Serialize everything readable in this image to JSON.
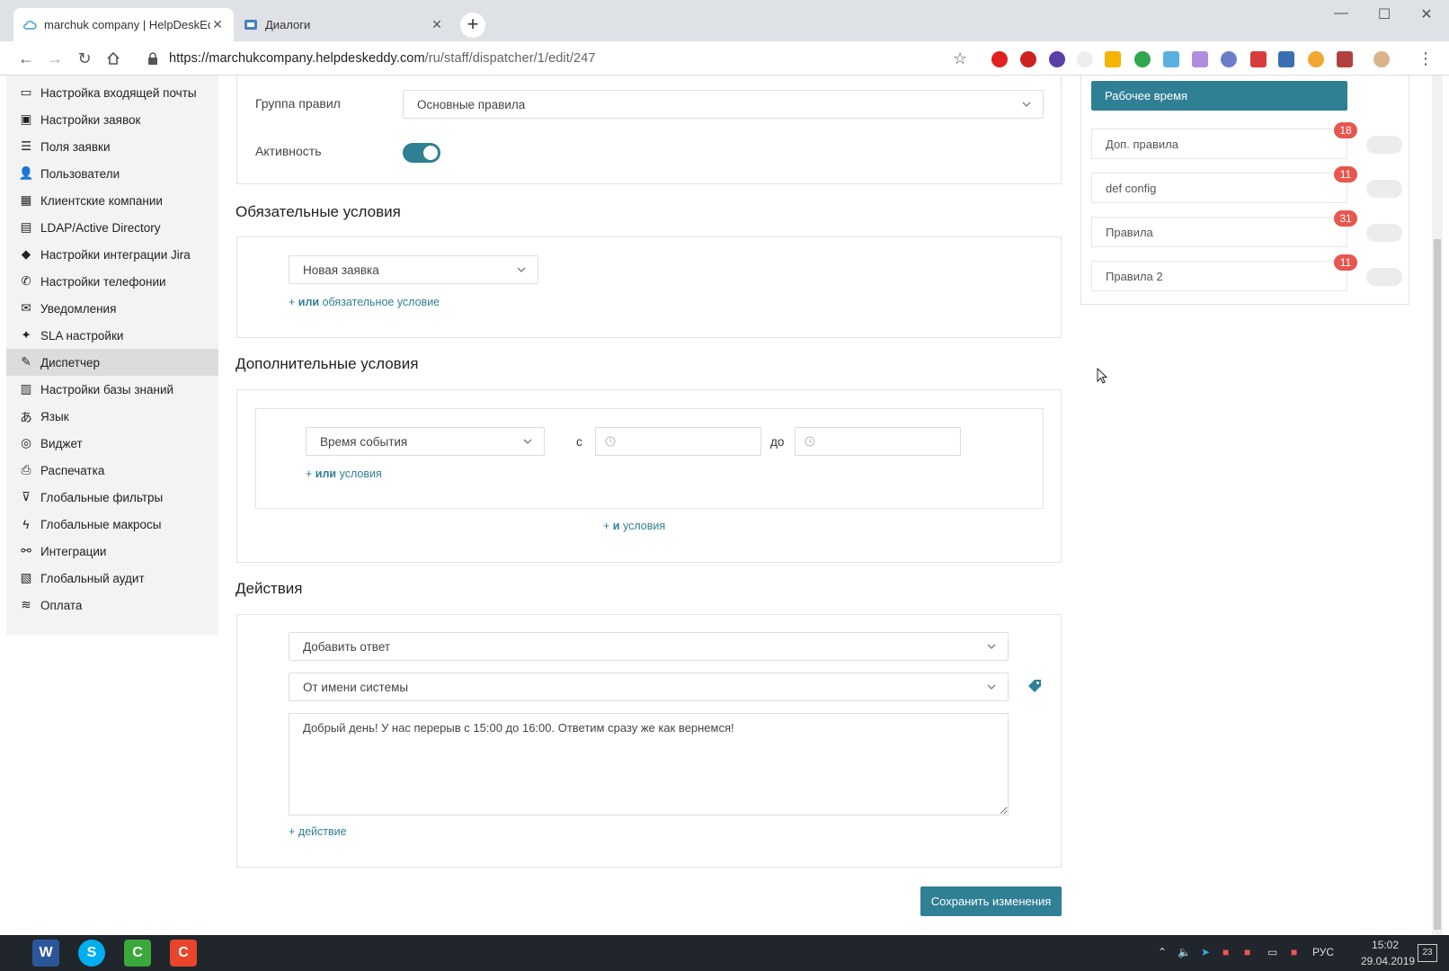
{
  "browser": {
    "tabs": [
      {
        "title": "marchuk company | HelpDeskEddy",
        "active": true
      },
      {
        "title": "Диалоги",
        "active": false
      }
    ],
    "url_main": "https://marchukcompany.helpdeskeddy.com",
    "url_path": "/ru/staff/dispatcher/1/edit/247"
  },
  "sidebar": {
    "items": [
      {
        "label": "Настройка входящей почты",
        "icon": "inbox-icon"
      },
      {
        "label": "Настройки заявок",
        "icon": "ticket-settings-icon"
      },
      {
        "label": "Поля заявки",
        "icon": "fields-icon"
      },
      {
        "label": "Пользователи",
        "icon": "users-icon"
      },
      {
        "label": "Клиентские компании",
        "icon": "company-icon"
      },
      {
        "label": "LDAP/Active Directory",
        "icon": "ldap-icon"
      },
      {
        "label": "Настройки интеграции Jira",
        "icon": "jira-icon"
      },
      {
        "label": "Настройки телефонии",
        "icon": "phone-icon"
      },
      {
        "label": "Уведомления",
        "icon": "envelope-icon"
      },
      {
        "label": "SLA настройки",
        "icon": "handshake-icon"
      },
      {
        "label": "Диспетчер",
        "icon": "wand-icon",
        "active": true
      },
      {
        "label": "Настройки базы знаний",
        "icon": "book-icon"
      },
      {
        "label": "Язык",
        "icon": "language-icon"
      },
      {
        "label": "Виджет",
        "icon": "widget-icon"
      },
      {
        "label": "Распечатка",
        "icon": "printer-icon"
      },
      {
        "label": "Глобальные фильтры",
        "icon": "filter-icon"
      },
      {
        "label": "Глобальные макросы",
        "icon": "macro-icon"
      },
      {
        "label": "Интеграции",
        "icon": "integration-icon"
      },
      {
        "label": "Глобальный аудит",
        "icon": "audit-icon"
      },
      {
        "label": "Оплата",
        "icon": "payment-icon"
      }
    ]
  },
  "form": {
    "group_label": "Группа правил",
    "group_value": "Основные правила",
    "activity_label": "Активность",
    "activity_on": true,
    "required_title": "Обязательные условия",
    "required_select": "Новая заявка",
    "required_add_prefix": "+",
    "required_add_bold": "или",
    "required_add_text": "обязательное условие",
    "additional_title": "Дополнительные условия",
    "additional_select": "Время события",
    "from_label": "с",
    "to_label": "до",
    "or_prefix": "+",
    "or_bold": "или",
    "or_text": "условия",
    "and_prefix": "+",
    "and_bold": "и",
    "and_text": "условия",
    "actions_title": "Действия",
    "action_select": "Добавить ответ",
    "sender_select": "От имени системы",
    "message": "Добрый день! У нас перерыв с 15:00 до 16:00. Ответим сразу же как вернемся!",
    "add_action": "+ действие",
    "save_button": "Сохранить изменения"
  },
  "right_panel": {
    "active_rule": "Рабочее время",
    "rules": [
      {
        "name": "Доп. правила",
        "count": "18",
        "enabled": false
      },
      {
        "name": "def config",
        "count": "11",
        "enabled": false
      },
      {
        "name": "Правила",
        "count": "31",
        "enabled": false
      },
      {
        "name": "Правила 2",
        "count": "11",
        "enabled": false
      }
    ]
  },
  "taskbar": {
    "lang": "РУС",
    "time": "15:02",
    "date": "29.04.2019",
    "notifications": "23"
  },
  "colors": {
    "accent": "#2f7f95",
    "badge": "#e5574f",
    "sidebar_bg": "#f3f3f3"
  }
}
